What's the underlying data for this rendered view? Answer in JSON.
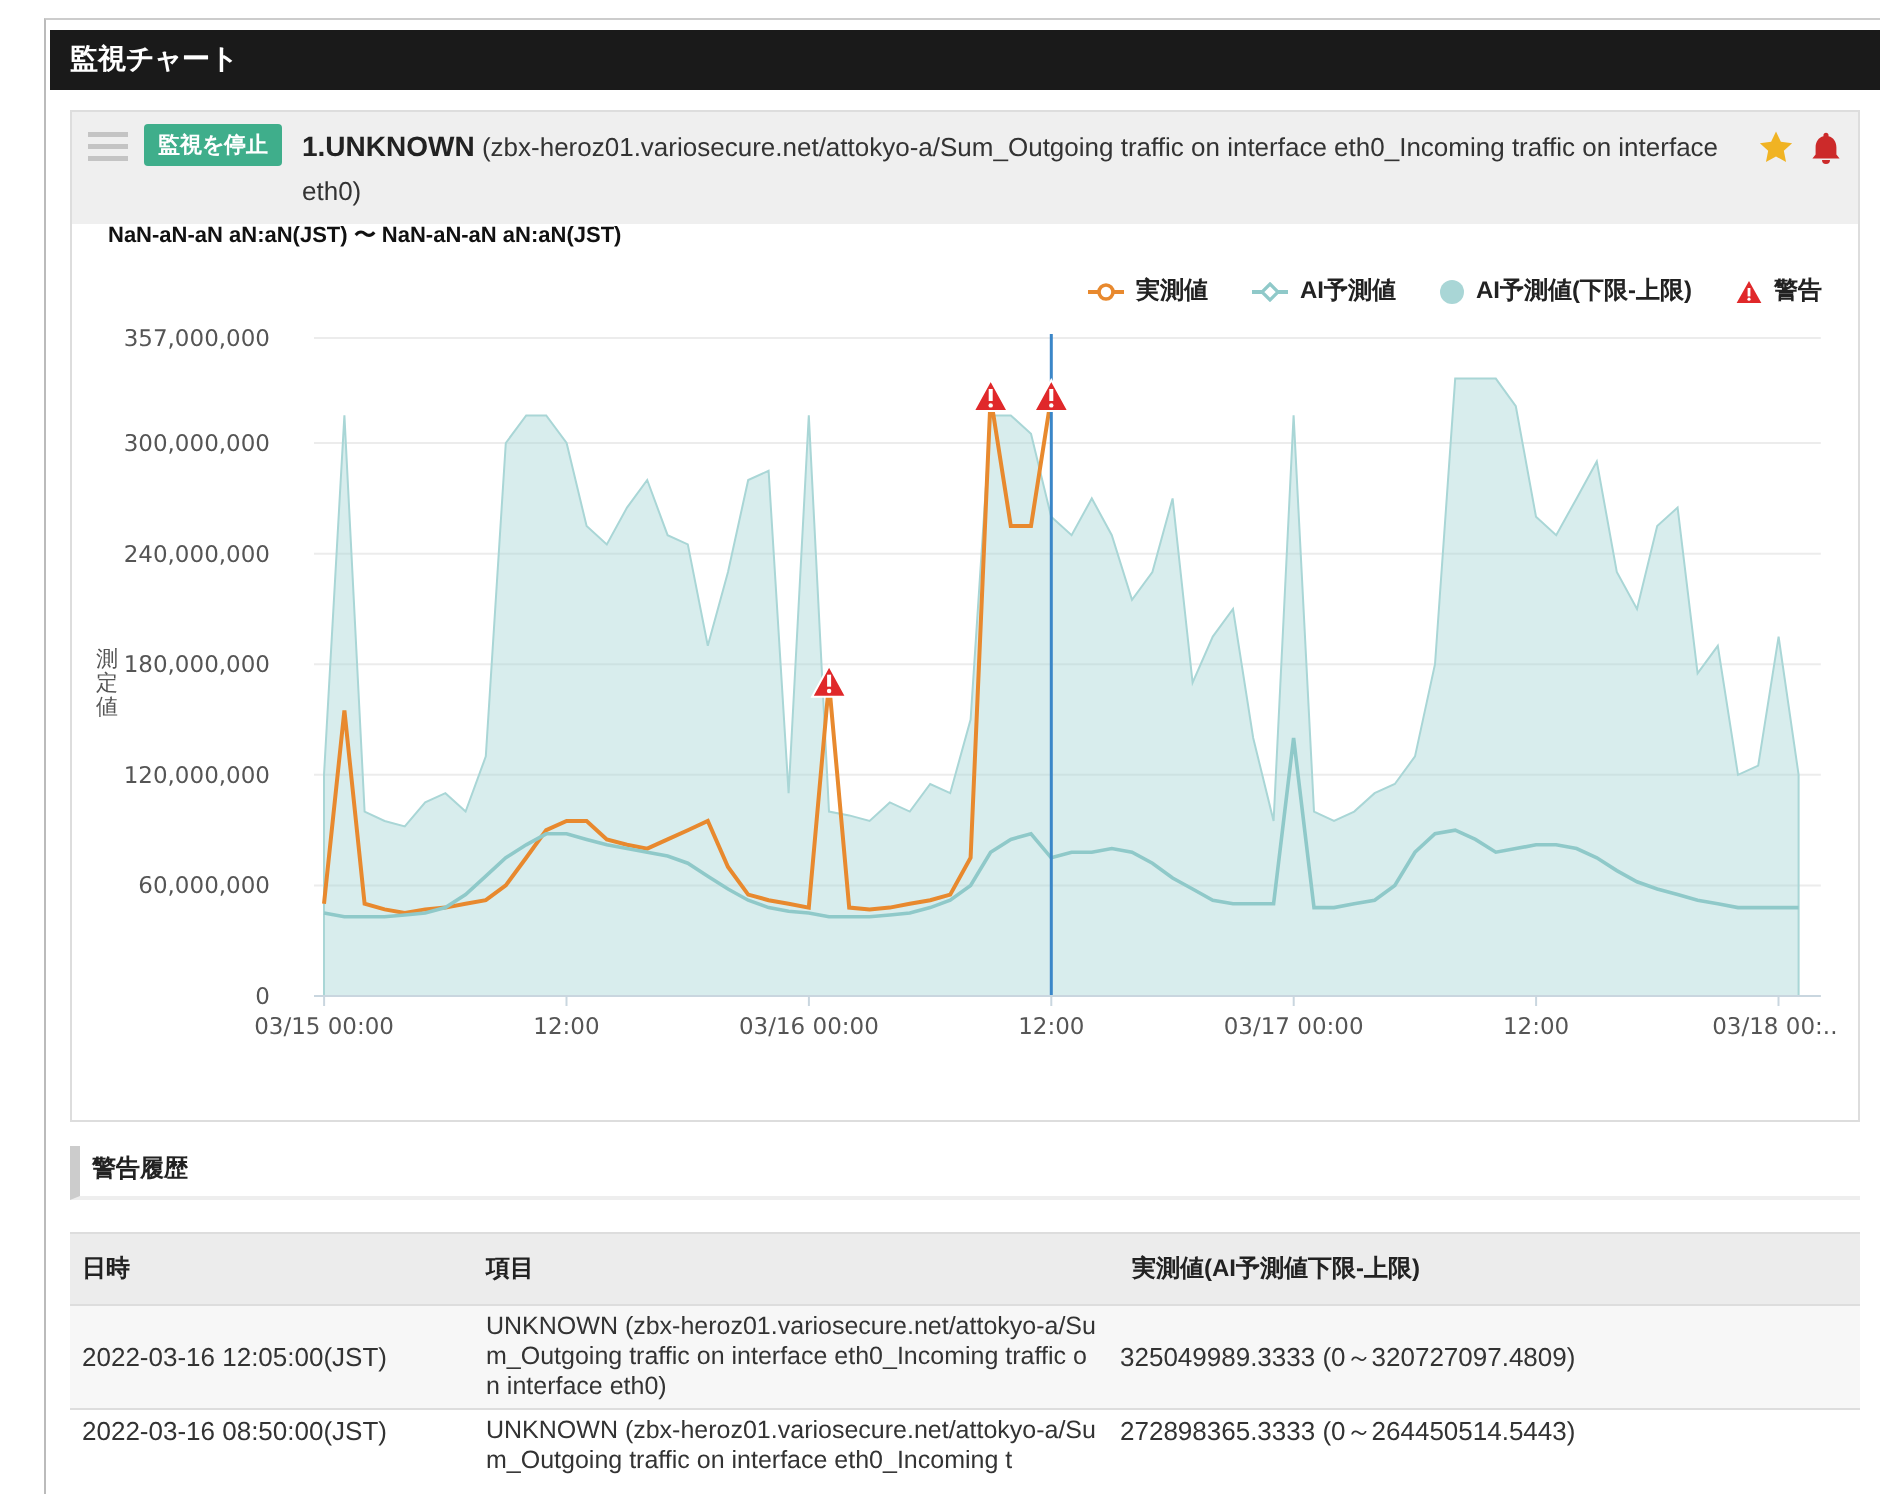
{
  "panel": {
    "title": "監視チャート"
  },
  "monitor": {
    "stop_button": "監視を停止",
    "title": "**1.UNKNOWN** (zbx-heroz01.variosecure.net/attokyo-a/Sum_Outgoing traffic on interface eth0_Incoming traffic on interface eth0)",
    "favorite": true,
    "notifications": true
  },
  "chart": {
    "range": "NaN-aN-aN aN:aN(JST) 〜 NaN-aN-aN aN:aN(JST)",
    "warning_legend": "警告",
    "chart_data": {
      "type": "line",
      "ylabel": "測定値",
      "ylim": [
        0,
        357000000
      ],
      "grid": true,
      "categories": [
        "03/15 00:00",
        null,
        null,
        null,
        null,
        null,
        null,
        null,
        null,
        null,
        null,
        null,
        "12:00",
        null,
        null,
        null,
        null,
        null,
        null,
        null,
        null,
        null,
        null,
        null,
        "03/16 00:00",
        null,
        null,
        null,
        null,
        null,
        null,
        null,
        null,
        null,
        null,
        null,
        "12:00",
        null,
        null,
        null,
        null,
        null,
        null,
        null,
        null,
        null,
        null,
        null,
        "03/17 00:00",
        null,
        null,
        null,
        null,
        null,
        null,
        null,
        null,
        null,
        null,
        null,
        "12:00",
        null,
        null,
        null,
        null,
        null,
        null,
        null,
        null,
        null,
        null,
        null,
        "03/18 00:...",
        null
      ],
      "series": [
        {
          "name": "実測値",
          "type": "line",
          "color": "#e8892e",
          "values": [
            50000000,
            155000000,
            50000000,
            47000000,
            45000000,
            47000000,
            48000000,
            50000000,
            52000000,
            60000000,
            75000000,
            90000000,
            95000000,
            95000000,
            85000000,
            82000000,
            80000000,
            85000000,
            90000000,
            95000000,
            70000000,
            55000000,
            52000000,
            50000000,
            48000000,
            170000000,
            48000000,
            47000000,
            48000000,
            50000000,
            52000000,
            55000000,
            75000000,
            325000000,
            255000000,
            255000000,
            325000000,
            null,
            null,
            null,
            null,
            null,
            null,
            null,
            null,
            null,
            null,
            null,
            null,
            null,
            null,
            null,
            null,
            null,
            null,
            null,
            null,
            null,
            null,
            null,
            null,
            null,
            null,
            null,
            null,
            null,
            null,
            null,
            null,
            null,
            null,
            null,
            null,
            null
          ]
        },
        {
          "name": "AI予測値",
          "type": "line",
          "color": "#8fc9c9",
          "values": [
            45000000,
            43000000,
            43000000,
            43000000,
            44000000,
            45000000,
            48000000,
            55000000,
            65000000,
            75000000,
            82000000,
            88000000,
            88000000,
            85000000,
            82000000,
            80000000,
            78000000,
            76000000,
            72000000,
            65000000,
            58000000,
            52000000,
            48000000,
            46000000,
            45000000,
            43000000,
            43000000,
            43000000,
            44000000,
            45000000,
            48000000,
            52000000,
            60000000,
            78000000,
            85000000,
            88000000,
            75000000,
            78000000,
            78000000,
            80000000,
            78000000,
            72000000,
            64000000,
            58000000,
            52000000,
            50000000,
            50000000,
            50000000,
            140000000,
            48000000,
            48000000,
            50000000,
            52000000,
            60000000,
            78000000,
            88000000,
            90000000,
            85000000,
            78000000,
            80000000,
            82000000,
            82000000,
            80000000,
            75000000,
            68000000,
            62000000,
            58000000,
            55000000,
            52000000,
            50000000,
            48000000,
            48000000,
            48000000,
            48000000
          ]
        },
        {
          "name": "AI予測値(下限-上限)",
          "type": "area",
          "color": "#a9d6d6",
          "values": [
            120000000,
            315000000,
            100000000,
            95000000,
            92000000,
            105000000,
            110000000,
            100000000,
            130000000,
            300000000,
            315000000,
            315000000,
            300000000,
            255000000,
            245000000,
            265000000,
            280000000,
            250000000,
            245000000,
            190000000,
            230000000,
            280000000,
            285000000,
            110000000,
            315000000,
            100000000,
            98000000,
            95000000,
            105000000,
            100000000,
            115000000,
            110000000,
            150000000,
            315000000,
            315000000,
            305000000,
            260000000,
            250000000,
            270000000,
            250000000,
            215000000,
            230000000,
            270000000,
            170000000,
            195000000,
            210000000,
            140000000,
            95000000,
            315000000,
            100000000,
            95000000,
            100000000,
            110000000,
            115000000,
            130000000,
            180000000,
            335000000,
            335000000,
            335000000,
            320000000,
            260000000,
            250000000,
            270000000,
            290000000,
            230000000,
            210000000,
            255000000,
            265000000,
            175000000,
            190000000,
            120000000,
            125000000,
            195000000,
            120000000
          ]
        }
      ],
      "yticks": [
        {
          "value": 0,
          "label": "0"
        },
        {
          "value": 60000000,
          "label": "60,000,000"
        },
        {
          "value": 120000000,
          "label": "120,000,000"
        },
        {
          "value": 180000000,
          "label": "180,000,000"
        },
        {
          "value": 240000000,
          "label": "240,000,000"
        },
        {
          "value": 300000000,
          "label": "300,000,000"
        },
        {
          "value": 357000000,
          "label": "357,000,000"
        }
      ]
    }
  },
  "history": {
    "title": "警告履歴",
    "columns": [
      "日時",
      "項目",
      "実測値(AI予測値下限-上限)"
    ],
    "rows": [
      [
        "2022-03-16 12:05:00(JST)",
        "UNKNOWN (zbx-heroz01.variosecure.net/attokyo-a/Sum_Outgoing traffic on interface eth0_Incoming traffic on interface eth0)",
        "325049989.3333 (0～320727097.4809)"
      ],
      [
        "2022-03-16 08:50:00(JST)",
        "UNKNOWN (zbx-heroz01.variosecure.net/attokyo-a/Sum_Outgoing traffic on interface eth0_Incoming t",
        "272898365.3333 (0～264450514.5443)"
      ]
    ]
  }
}
